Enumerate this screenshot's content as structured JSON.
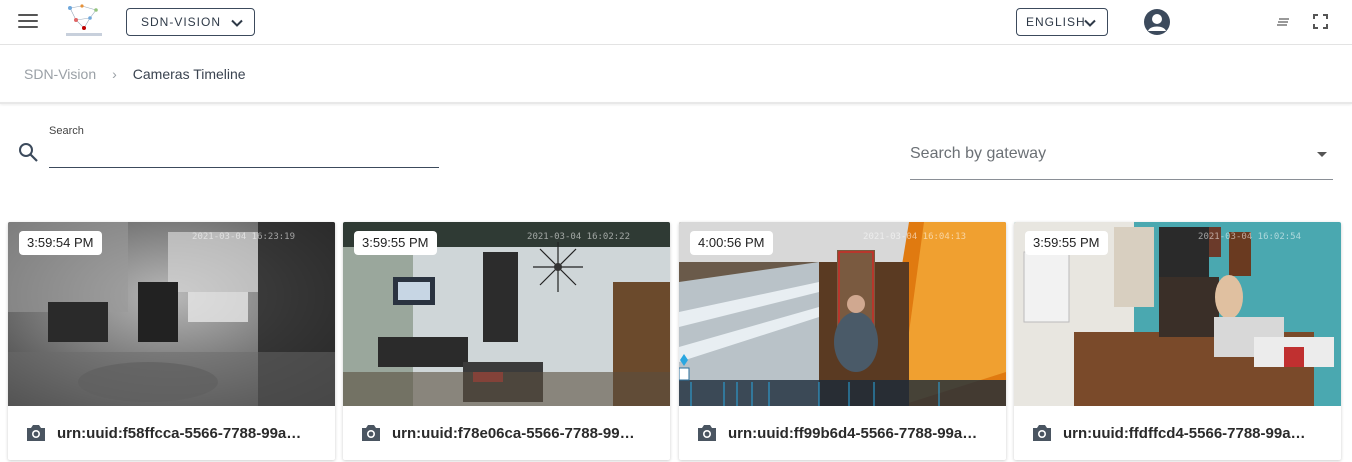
{
  "header": {
    "org_selector": "SDN-VISION",
    "language_selector": "ENGLISH"
  },
  "breadcrumb": {
    "root": "SDN-Vision",
    "separator": "›",
    "current": "Cameras Timeline"
  },
  "search": {
    "label": "Search",
    "value": ""
  },
  "gateway": {
    "placeholder": "Search by gateway"
  },
  "cameras": [
    {
      "time": "3:59:54 PM",
      "camera_timestamp": "2021-03-04 16:23:19",
      "urn": "urn:uuid:f58ffcca-5566-7788-99a…",
      "icon": "camera-icon"
    },
    {
      "time": "3:59:55 PM",
      "camera_timestamp": "2021-03-04 16:02:22",
      "urn": "urn:uuid:f78e06ca-5566-7788-99…",
      "icon": "camera-icon"
    },
    {
      "time": "4:00:56 PM",
      "camera_timestamp": "2021-03-04 16:04:13",
      "urn": "urn:uuid:ff99b6d4-5566-7788-99a…",
      "icon": "camera-icon"
    },
    {
      "time": "3:59:55 PM",
      "camera_timestamp": "2021-03-04 16:02:54",
      "urn": "urn:uuid:ffdffcd4-5566-7788-99a…",
      "icon": "camera-icon"
    }
  ],
  "colors": {
    "primary_dark": "#2f3a48",
    "detection_box": "#e02020",
    "timeline_marker": "#2aa6e0"
  }
}
